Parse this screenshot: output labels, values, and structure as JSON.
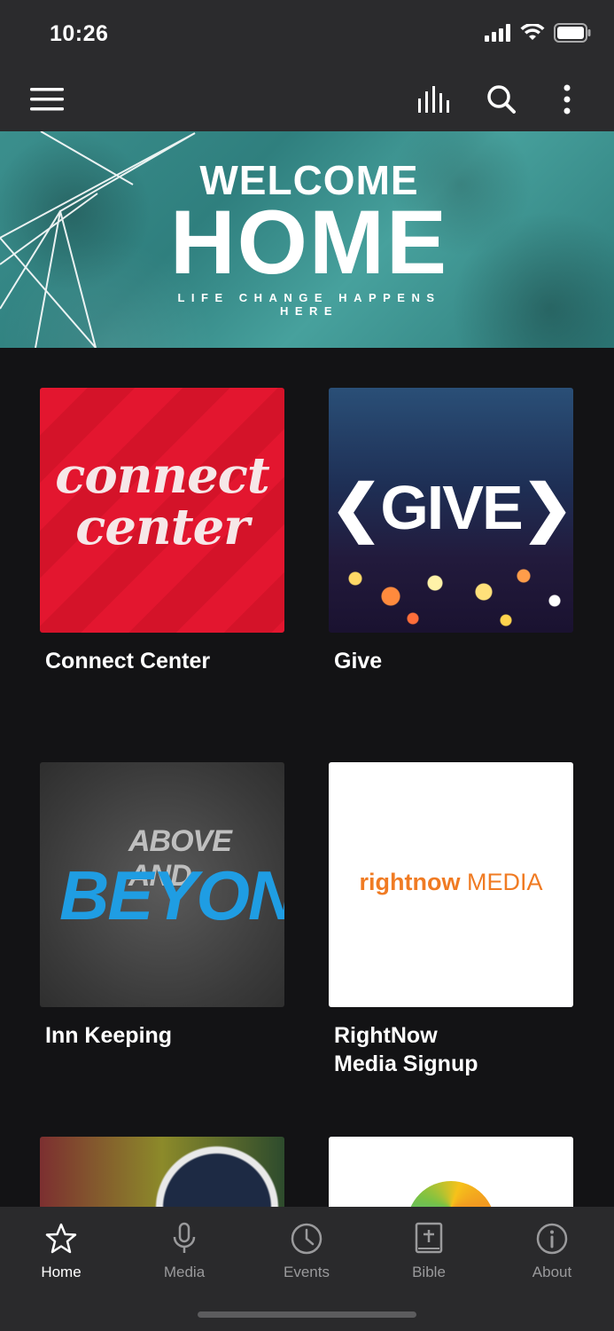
{
  "status_bar": {
    "time": "10:26"
  },
  "banner": {
    "line1": "WELCOME",
    "line2": "HOME",
    "tagline": "LIFE CHANGE HAPPENS HERE"
  },
  "tiles": [
    {
      "label": "Connect Center",
      "art_text": "connect center"
    },
    {
      "label": "Give",
      "art_text": "❮GIVE❯"
    },
    {
      "label": "Inn Keeping",
      "art_text_1": "ABOVE AND",
      "art_text_2": "BEYOND"
    },
    {
      "label": "RightNow\nMedia Signup",
      "art_text_1": "rightnow",
      "art_text_2": "MEDIA"
    }
  ],
  "tab_bar": {
    "items": [
      {
        "label": "Home",
        "icon": "star-icon",
        "active": true
      },
      {
        "label": "Media",
        "icon": "microphone-icon",
        "active": false
      },
      {
        "label": "Events",
        "icon": "clock-icon",
        "active": false
      },
      {
        "label": "Bible",
        "icon": "bible-icon",
        "active": false
      },
      {
        "label": "About",
        "icon": "info-icon",
        "active": false
      }
    ]
  },
  "colors": {
    "background": "#131315",
    "bar": "#2b2b2d",
    "banner_teal": "#3b8f8d",
    "connect_red": "#e3162f",
    "rightnow_orange": "#f07b23",
    "tab_inactive": "#9a9a9c"
  }
}
